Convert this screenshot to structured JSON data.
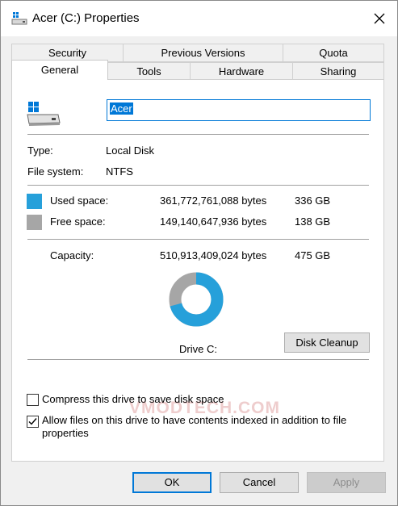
{
  "window": {
    "title": "Acer (C:) Properties",
    "icon": "drive-icon",
    "close_icon": "close-icon"
  },
  "tabs": {
    "row1": [
      {
        "label": "Security"
      },
      {
        "label": "Previous Versions"
      },
      {
        "label": "Quota"
      }
    ],
    "row2": [
      {
        "label": "General",
        "active": true
      },
      {
        "label": "Tools"
      },
      {
        "label": "Hardware"
      },
      {
        "label": "Sharing"
      }
    ]
  },
  "general": {
    "drive_name": "Acer",
    "type_label": "Type:",
    "type_value": "Local Disk",
    "fs_label": "File system:",
    "fs_value": "NTFS",
    "used": {
      "label": "Used space:",
      "bytes": "361,772,761,088 bytes",
      "size": "336 GB",
      "color": "#26a0da"
    },
    "free": {
      "label": "Free space:",
      "bytes": "149,140,647,936 bytes",
      "size": "138 GB",
      "color": "#a6a6a6"
    },
    "capacity": {
      "label": "Capacity:",
      "bytes": "510,913,409,024 bytes",
      "size": "475 GB"
    },
    "used_fraction": 0.708,
    "drive_label": "Drive C:",
    "disk_cleanup": "Disk Cleanup",
    "compress": {
      "label": "Compress this drive to save disk space",
      "checked": false
    },
    "index": {
      "label": "Allow files on this drive to have contents indexed in addition to file properties",
      "checked": true
    }
  },
  "watermark": "VMODTECH.COM",
  "buttons": {
    "ok": "OK",
    "cancel": "Cancel",
    "apply": "Apply"
  },
  "colors": {
    "accent": "#0078d7"
  }
}
